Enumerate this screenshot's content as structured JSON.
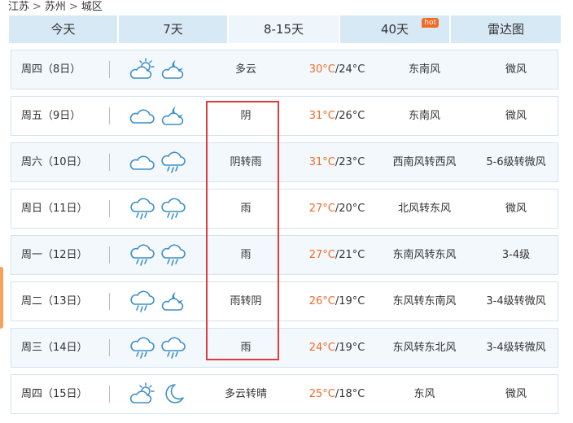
{
  "breadcrumb": [
    "江苏",
    "苏州",
    "城区"
  ],
  "tabs": [
    {
      "label": "今天",
      "active": false
    },
    {
      "label": "7天",
      "active": false
    },
    {
      "label": "8-15天",
      "active": true
    },
    {
      "label": "40天",
      "active": false,
      "badge": "hot"
    },
    {
      "label": "雷达图",
      "active": false
    }
  ],
  "colors": {
    "accent": "#f26b27",
    "tab_bg": "#d7e9f5",
    "highlight": "#e23b3b",
    "icon": "#3d8fc7"
  },
  "days": [
    {
      "day": "周四（8日）",
      "icons": [
        "partly-cloudy-day-icon",
        "partly-cloudy-night-icon"
      ],
      "desc": "多云",
      "high": "30°C",
      "low": "/24°C",
      "wind": "东南风",
      "level": "微风"
    },
    {
      "day": "周五（9日）",
      "icons": [
        "cloudy-icon",
        "partly-cloudy-night-icon"
      ],
      "desc": "阴",
      "high": "31°C",
      "low": "/26°C",
      "wind": "东南风",
      "level": "微风"
    },
    {
      "day": "周六（10日）",
      "icons": [
        "cloudy-icon",
        "rain-icon"
      ],
      "desc": "阴转雨",
      "high": "31°C",
      "low": "/23°C",
      "wind": "西南风转西风",
      "level": "5-6级转微风"
    },
    {
      "day": "周日（11日）",
      "icons": [
        "rain-icon",
        "rain-icon"
      ],
      "desc": "雨",
      "high": "27°C",
      "low": "/20°C",
      "wind": "北风转东风",
      "level": "微风"
    },
    {
      "day": "周一（12日）",
      "icons": [
        "rain-icon",
        "rain-icon"
      ],
      "desc": "雨",
      "high": "27°C",
      "low": "/21°C",
      "wind": "东南风转东风",
      "level": "3-4级"
    },
    {
      "day": "周二（13日）",
      "icons": [
        "rain-icon",
        "partly-cloudy-night-icon"
      ],
      "desc": "雨转阴",
      "high": "26°C",
      "low": "/19°C",
      "wind": "东风转东南风",
      "level": "3-4级转微风"
    },
    {
      "day": "周三（14日）",
      "icons": [
        "rain-icon",
        "rain-icon"
      ],
      "desc": "雨",
      "high": "24°C",
      "low": "/19°C",
      "wind": "东风转东北风",
      "level": "3-4级转微风"
    },
    {
      "day": "周四（15日）",
      "icons": [
        "partly-cloudy-day-icon",
        "moon-icon"
      ],
      "desc": "多云转晴",
      "high": "25°C",
      "low": "/18°C",
      "wind": "东风",
      "level": "微风"
    }
  ]
}
